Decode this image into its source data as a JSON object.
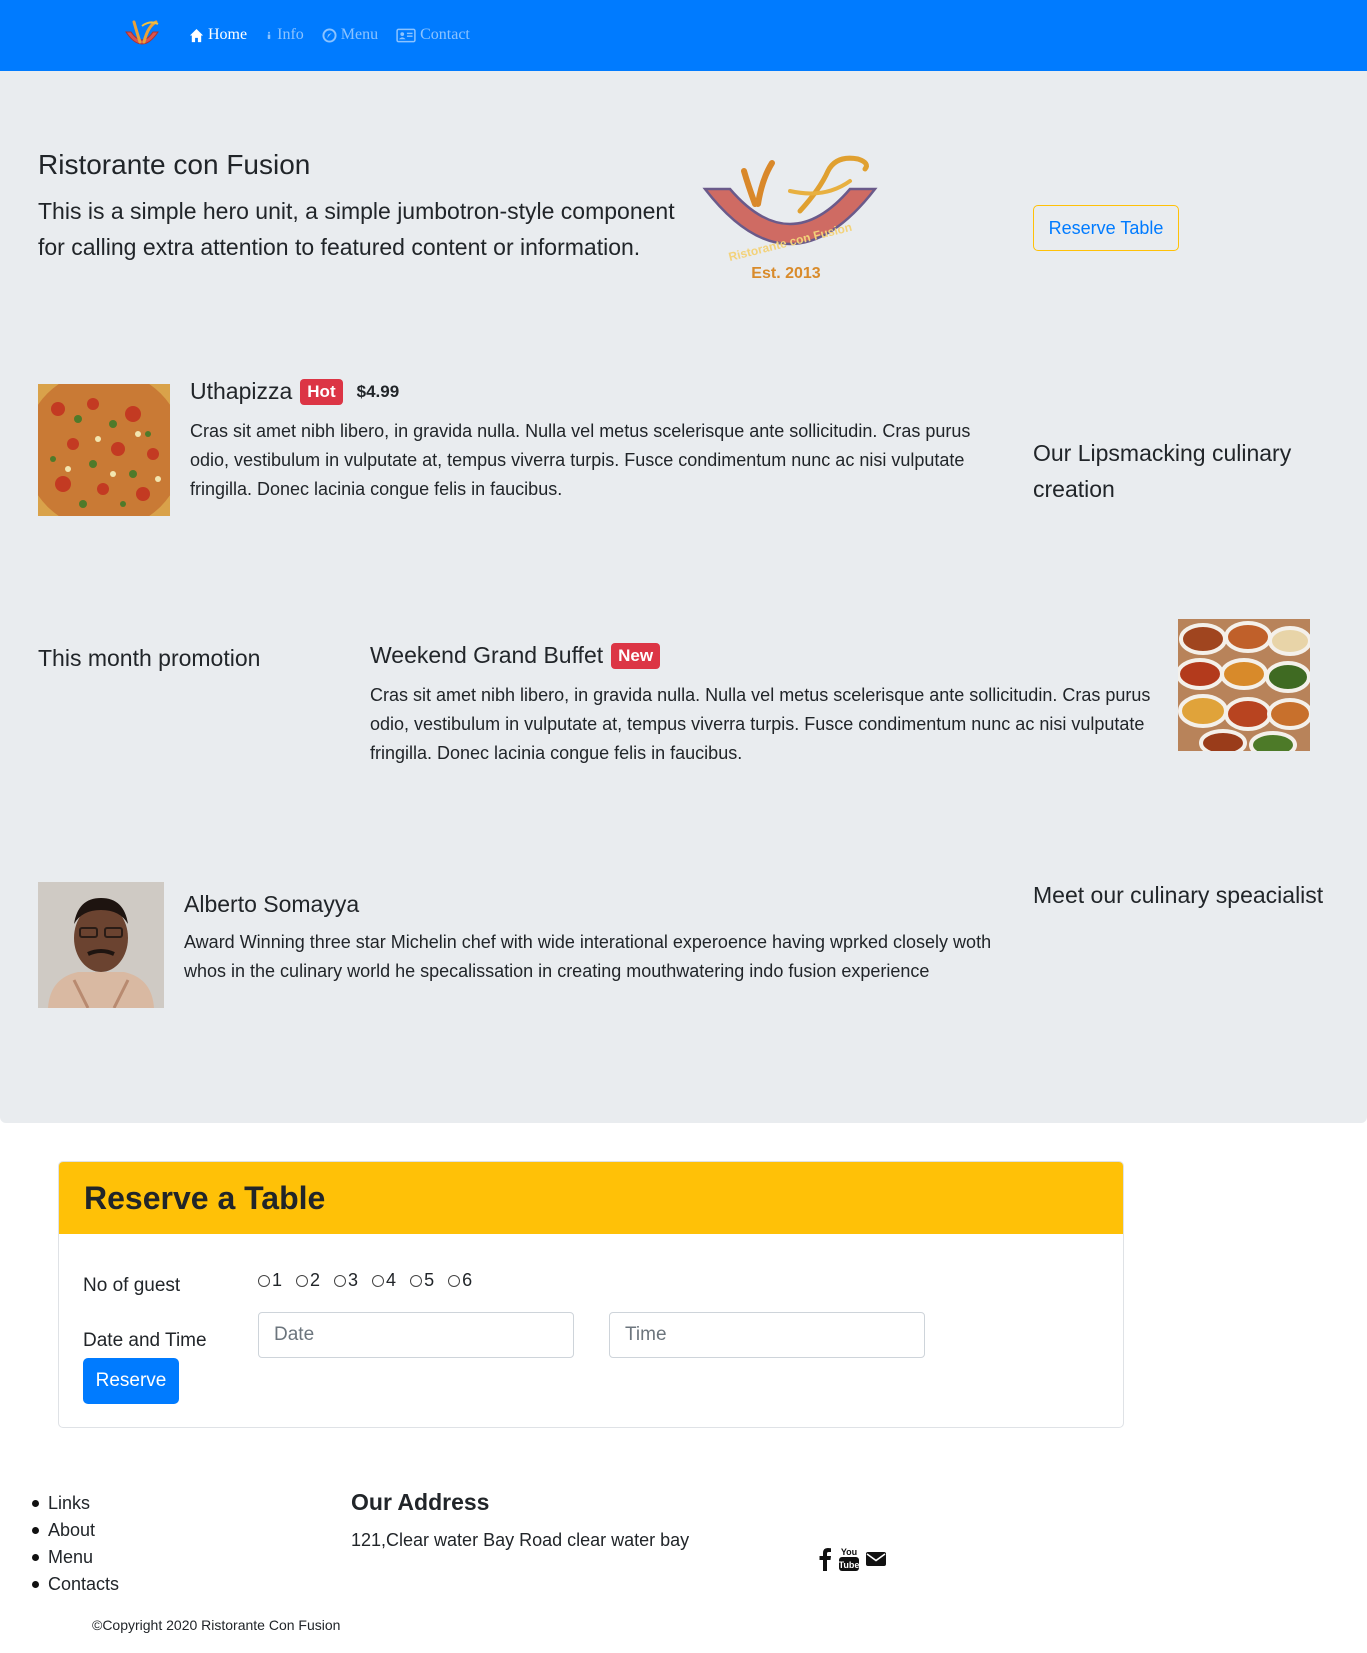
{
  "nav": {
    "logo_name": "restaurant-logo",
    "items": [
      {
        "label": "Home",
        "icon": "home-icon",
        "active": true
      },
      {
        "label": "Info",
        "icon": "info-icon",
        "active": false
      },
      {
        "label": "Menu",
        "icon": "list-icon",
        "active": false
      },
      {
        "label": "Contact",
        "icon": "address-card-icon",
        "active": false
      }
    ],
    "bg_color": "#007bff"
  },
  "hero": {
    "title": "Ristorante con Fusion",
    "lead": "This is a simple hero unit, a simple jumbotron-style component for calling extra attention to featured content or information.",
    "logo_text": "Ristorante con Fusion",
    "logo_est": "Est. 2013",
    "reserve_button": "Reserve Table"
  },
  "dish": {
    "name": "Uthapizza",
    "badge": "Hot",
    "price": "$4.99",
    "description": "Cras sit amet nibh libero, in gravida nulla. Nulla vel metus scelerisque ante sollicitudin. Cras purus odio, vestibulum in vulputate at, tempus viverra turpis. Fusce condimentum nunc ac nisi vulputate fringilla. Donec lacinia congue felis in faucibus.",
    "side_text": "Our Lipsmacking culinary creation"
  },
  "promotion": {
    "side_text": "This month promotion",
    "name": "Weekend Grand Buffet",
    "badge": "New",
    "description": "Cras sit amet nibh libero, in gravida nulla. Nulla vel metus scelerisque ante sollicitudin. Cras purus odio, vestibulum in vulputate at, tempus viverra turpis. Fusce condimentum nunc ac nisi vulputate fringilla. Donec lacinia congue felis in faucibus."
  },
  "chef": {
    "name": "Alberto Somayya",
    "description": "Award Winning three star Michelin chef with wide interational experoence having wprked closely woth whos in the culinary world he specalissation in creating mouthwatering indo fusion experience",
    "side_text": "Meet our culinary speacialist"
  },
  "reservation": {
    "title": "Reserve a Table",
    "guest_label": "No of guest",
    "guest_options": [
      "1",
      "2",
      "3",
      "4",
      "5",
      "6"
    ],
    "datetime_label": "Date and Time",
    "date_placeholder": "Date",
    "time_placeholder": "Time",
    "submit_label": "Reserve",
    "header_color": "#ffc107"
  },
  "footer": {
    "links": [
      "Links",
      "About",
      "Menu",
      "Contacts"
    ],
    "address_title": "Our Address",
    "address": "121,Clear water Bay Road clear water bay",
    "social_icons": [
      "facebook-icon",
      "youtube-icon",
      "envelope-icon"
    ],
    "copyright": "©Copyright 2020 Ristorante Con Fusion"
  }
}
